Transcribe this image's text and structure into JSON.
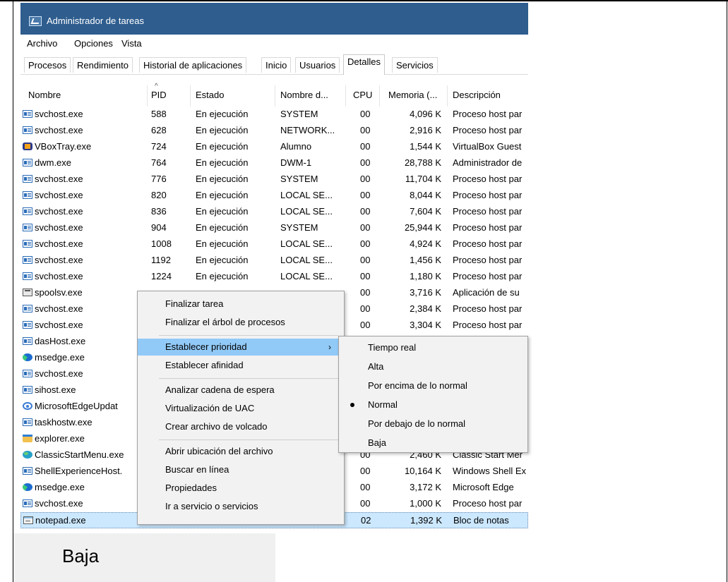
{
  "window": {
    "title": "Administrador de tareas"
  },
  "menu": [
    "Archivo",
    "Opciones",
    "Vista"
  ],
  "tabs": [
    {
      "label": "Procesos"
    },
    {
      "label": "Rendimiento"
    },
    {
      "label": "Historial de aplicaciones"
    },
    {
      "label": "Inicio"
    },
    {
      "label": "Usuarios"
    },
    {
      "label": "Detalles",
      "active": true
    },
    {
      "label": "Servicios"
    }
  ],
  "columns": {
    "name": "Nombre",
    "pid": "PID",
    "status": "Estado",
    "user": "Nombre d...",
    "cpu": "CPU",
    "memory": "Memoria (...",
    "description": "Descripción"
  },
  "processes": [
    {
      "icon": "service-icon",
      "name": "svchost.exe",
      "pid": "588",
      "status": "En ejecución",
      "user": "SYSTEM",
      "cpu": "00",
      "mem": "4,096 K",
      "desc": "Proceso host par"
    },
    {
      "icon": "service-icon",
      "name": "svchost.exe",
      "pid": "628",
      "status": "En ejecución",
      "user": "NETWORK...",
      "cpu": "00",
      "mem": "2,916 K",
      "desc": "Proceso host par"
    },
    {
      "icon": "virtualbox-icon",
      "name": "VBoxTray.exe",
      "pid": "724",
      "status": "En ejecución",
      "user": "Alumno",
      "cpu": "00",
      "mem": "1,544 K",
      "desc": "VirtualBox Guest"
    },
    {
      "icon": "service-icon",
      "name": "dwm.exe",
      "pid": "764",
      "status": "En ejecución",
      "user": "DWM-1",
      "cpu": "00",
      "mem": "28,788 K",
      "desc": "Administrador de"
    },
    {
      "icon": "service-icon",
      "name": "svchost.exe",
      "pid": "776",
      "status": "En ejecución",
      "user": "SYSTEM",
      "cpu": "00",
      "mem": "11,704 K",
      "desc": "Proceso host par"
    },
    {
      "icon": "service-icon",
      "name": "svchost.exe",
      "pid": "820",
      "status": "En ejecución",
      "user": "LOCAL SE...",
      "cpu": "00",
      "mem": "8,044 K",
      "desc": "Proceso host par"
    },
    {
      "icon": "service-icon",
      "name": "svchost.exe",
      "pid": "836",
      "status": "En ejecución",
      "user": "LOCAL SE...",
      "cpu": "00",
      "mem": "7,604 K",
      "desc": "Proceso host par"
    },
    {
      "icon": "service-icon",
      "name": "svchost.exe",
      "pid": "904",
      "status": "En ejecución",
      "user": "SYSTEM",
      "cpu": "00",
      "mem": "25,944 K",
      "desc": "Proceso host par"
    },
    {
      "icon": "service-icon",
      "name": "svchost.exe",
      "pid": "1008",
      "status": "En ejecución",
      "user": "LOCAL SE...",
      "cpu": "00",
      "mem": "4,924 K",
      "desc": "Proceso host par"
    },
    {
      "icon": "service-icon",
      "name": "svchost.exe",
      "pid": "1192",
      "status": "En ejecución",
      "user": "LOCAL SE...",
      "cpu": "00",
      "mem": "1,456 K",
      "desc": "Proceso host par"
    },
    {
      "icon": "service-icon",
      "name": "svchost.exe",
      "pid": "1224",
      "status": "En ejecución",
      "user": "LOCAL SE...",
      "cpu": "00",
      "mem": "1,180 K",
      "desc": "Proceso host par"
    },
    {
      "icon": "printer-icon",
      "name": "spoolsv.exe",
      "pid": "",
      "status": "",
      "user": "",
      "cpu": "00",
      "mem": "3,716 K",
      "desc": "Aplicación de su"
    },
    {
      "icon": "service-icon",
      "name": "svchost.exe",
      "pid": "",
      "status": "",
      "user": "",
      "cpu": "00",
      "mem": "2,384 K",
      "desc": "Proceso host par"
    },
    {
      "icon": "service-icon",
      "name": "svchost.exe",
      "pid": "",
      "status": "",
      "user": "",
      "cpu": "00",
      "mem": "3,304 K",
      "desc": "Proceso host par"
    },
    {
      "icon": "service-icon",
      "name": "dasHost.exe",
      "pid": "",
      "status": "",
      "user": "",
      "cpu": "",
      "mem": "",
      "desc": ""
    },
    {
      "icon": "edge-icon",
      "name": "msedge.exe",
      "pid": "",
      "status": "",
      "user": "",
      "cpu": "",
      "mem": "",
      "desc": ""
    },
    {
      "icon": "service-icon",
      "name": "svchost.exe",
      "pid": "",
      "status": "",
      "user": "",
      "cpu": "",
      "mem": "",
      "desc": ""
    },
    {
      "icon": "service-icon",
      "name": "sihost.exe",
      "pid": "",
      "status": "",
      "user": "",
      "cpu": "",
      "mem": "",
      "desc": ""
    },
    {
      "icon": "update-icon",
      "name": "MicrosoftEdgeUpdat",
      "pid": "",
      "status": "",
      "user": "",
      "cpu": "",
      "mem": "",
      "desc": ""
    },
    {
      "icon": "service-icon",
      "name": "taskhostw.exe",
      "pid": "",
      "status": "",
      "user": "",
      "cpu": "",
      "mem": "",
      "desc": ""
    },
    {
      "icon": "folder-icon",
      "name": "explorer.exe",
      "pid": "",
      "status": "",
      "user": "",
      "cpu": "",
      "mem": "",
      "desc": ""
    },
    {
      "icon": "globe-icon",
      "name": "ClassicStartMenu.exe",
      "pid": "",
      "status": "",
      "user": "",
      "cpu": "00",
      "mem": "2,460 K",
      "desc": "Classic Start Mer"
    },
    {
      "icon": "service-icon",
      "name": "ShellExperienceHost.",
      "pid": "",
      "status": "",
      "user": "",
      "cpu": "00",
      "mem": "10,164 K",
      "desc": "Windows Shell Ex"
    },
    {
      "icon": "edge-icon",
      "name": "msedge.exe",
      "pid": "",
      "status": "",
      "user": "",
      "cpu": "00",
      "mem": "3,172 K",
      "desc": "Microsoft Edge"
    },
    {
      "icon": "service-icon",
      "name": "svchost.exe",
      "pid": "",
      "status": "",
      "user": "",
      "cpu": "00",
      "mem": "1,000 K",
      "desc": "Proceso host par"
    },
    {
      "icon": "notepad-icon",
      "name": "notepad.exe",
      "pid": "",
      "status": "",
      "user": "",
      "cpu": "02",
      "mem": "1,392 K",
      "desc": "Bloc de notas",
      "selected": true
    }
  ],
  "context_menu": [
    {
      "label": "Finalizar tarea"
    },
    {
      "label": "Finalizar el árbol de procesos"
    },
    {
      "separator": true
    },
    {
      "label": "Establecer prioridad",
      "submenu": true,
      "hover": true
    },
    {
      "label": "Establecer afinidad"
    },
    {
      "separator": true
    },
    {
      "label": "Analizar cadena de espera"
    },
    {
      "label": "Virtualización de UAC"
    },
    {
      "label": "Crear archivo de volcado"
    },
    {
      "separator": true
    },
    {
      "label": "Abrir ubicación del archivo"
    },
    {
      "label": "Buscar en línea"
    },
    {
      "label": "Propiedades"
    },
    {
      "label": "Ir a servicio o servicios"
    }
  ],
  "priority_submenu": [
    {
      "label": "Tiempo real"
    },
    {
      "label": "Alta"
    },
    {
      "label": "Por encima de lo normal"
    },
    {
      "label": "Normal",
      "checked": true
    },
    {
      "label": "Por debajo de lo normal"
    },
    {
      "label": "Baja"
    }
  ],
  "zoom_label": "Baja"
}
